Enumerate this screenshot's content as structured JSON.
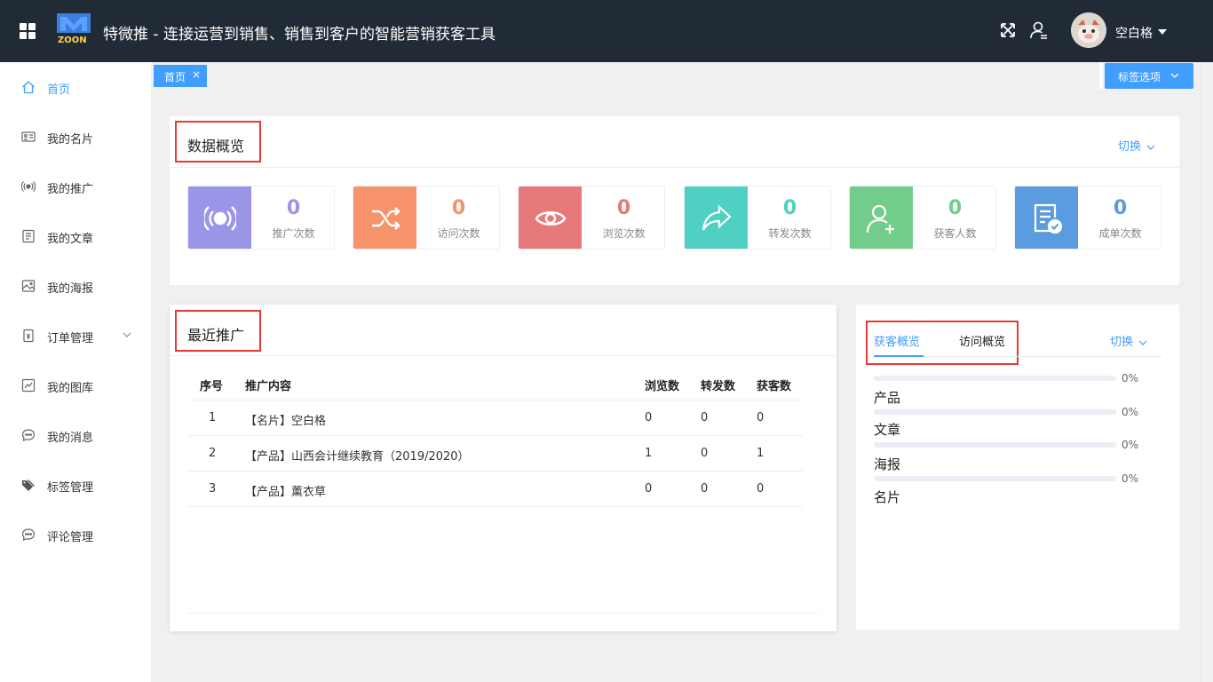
{
  "header": {
    "app_title": "特微推 - 连接运营到销售、销售到客户的智能营销获客工具",
    "logo_text": "ZOON",
    "user_name": "空白格"
  },
  "sidebar": {
    "items": [
      {
        "label": "首页",
        "icon": "home-icon",
        "active": true
      },
      {
        "label": "我的名片",
        "icon": "id-card-icon"
      },
      {
        "label": "我的推广",
        "icon": "broadcast-icon"
      },
      {
        "label": "我的文章",
        "icon": "document-icon"
      },
      {
        "label": "我的海报",
        "icon": "image-icon"
      },
      {
        "label": "订单管理",
        "icon": "order-icon",
        "expandable": true
      },
      {
        "label": "我的图库",
        "icon": "chart-icon"
      },
      {
        "label": "我的消息",
        "icon": "message-icon"
      },
      {
        "label": "标签管理",
        "icon": "tag-icon"
      },
      {
        "label": "评论管理",
        "icon": "comment-icon"
      }
    ]
  },
  "tabs": {
    "home_label": "首页",
    "close_glyph": "×",
    "options_label": "标签选项"
  },
  "overview": {
    "title": "数据概览",
    "switch_label": "切换",
    "stats": [
      {
        "value": "0",
        "label": "推广次数",
        "color": "#9a95e6",
        "icon": "broadcast-icon"
      },
      {
        "value": "0",
        "label": "访问次数",
        "color": "#f6936a",
        "icon": "shuffle-icon"
      },
      {
        "value": "0",
        "label": "浏览次数",
        "color": "#e8797a",
        "icon": "eye-icon"
      },
      {
        "value": "0",
        "label": "转发次数",
        "color": "#4fd0c3",
        "icon": "share-icon"
      },
      {
        "value": "0",
        "label": "获客人数",
        "color": "#72cc8a",
        "icon": "user-add-icon"
      },
      {
        "value": "0",
        "label": "成单次数",
        "color": "#5b9be0",
        "icon": "order-check-icon"
      }
    ]
  },
  "recent": {
    "title": "最近推广",
    "columns": [
      "序号",
      "推广内容",
      "浏览数",
      "转发数",
      "获客数"
    ],
    "rows": [
      {
        "no": "1",
        "content": "【名片】空白格",
        "views": "0",
        "shares": "0",
        "customers": "0"
      },
      {
        "no": "2",
        "content": "【产品】山西会计继续教育（2019/2020）",
        "views": "1",
        "shares": "0",
        "customers": "1"
      },
      {
        "no": "3",
        "content": "【产品】薰衣草",
        "views": "0",
        "shares": "0",
        "customers": "0"
      }
    ]
  },
  "side_overview": {
    "tab_active": "获客概览",
    "tab_other": "访问概览",
    "switch_label": "切换",
    "bars": [
      {
        "label": "产品",
        "percent": "0%",
        "fraction": 0
      },
      {
        "label": "文章",
        "percent": "0%",
        "fraction": 0
      },
      {
        "label": "海报",
        "percent": "0%",
        "fraction": 0
      },
      {
        "label": "名片",
        "percent": "0%",
        "fraction": 0
      }
    ]
  }
}
